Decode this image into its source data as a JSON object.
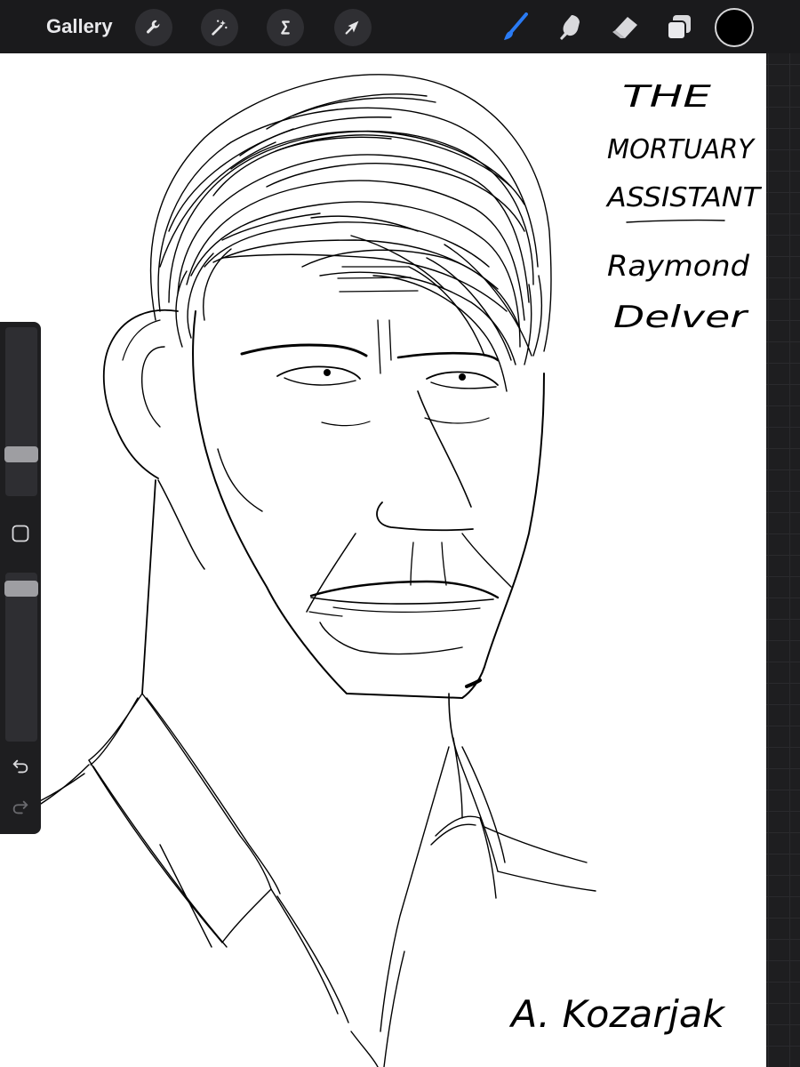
{
  "topbar": {
    "gallery_label": "Gallery",
    "left_tools": [
      {
        "name": "actions-wrench-icon"
      },
      {
        "name": "adjustments-wand-icon"
      },
      {
        "name": "selection-s-icon"
      },
      {
        "name": "transform-arrow-icon"
      }
    ],
    "right_tools": [
      {
        "name": "brush-icon",
        "active": true
      },
      {
        "name": "smudge-icon"
      },
      {
        "name": "eraser-icon"
      },
      {
        "name": "layers-icon"
      }
    ],
    "current_color": "#000000",
    "accent_color": "#2a7bf4"
  },
  "canvas": {
    "title_lines": [
      "THE",
      "MORTUARY",
      "ASSISTANT"
    ],
    "subtitle_lines": [
      "Raymond",
      "Delver"
    ],
    "signature": "A. Kozarjak"
  },
  "sidebar": {
    "brush_size_level": 0.78,
    "opacity_level": 0.05,
    "icons": [
      "modify-square-icon",
      "undo-icon",
      "redo-icon"
    ]
  }
}
